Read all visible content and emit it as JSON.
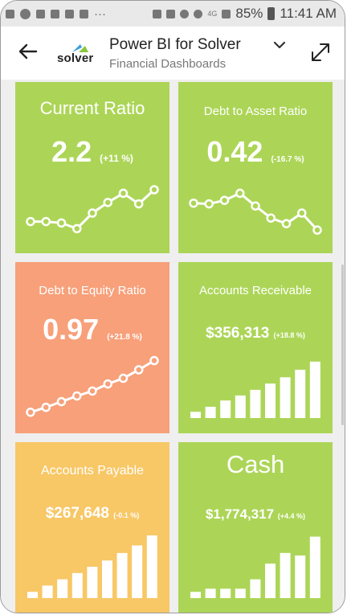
{
  "status": {
    "battery": "85%",
    "time": "11:41 AM",
    "network": "4G"
  },
  "header": {
    "logo": "solver",
    "title": "Power BI for Solver",
    "subtitle": "Financial Dashboards"
  },
  "tiles": [
    {
      "title": "Current Ratio",
      "value": "2.2",
      "change": "(+11 %)",
      "color": "#acd557",
      "visual": "line",
      "chart_data": {
        "type": "line",
        "values": [
          0.3,
          0.3,
          0.28,
          0.2,
          0.42,
          0.57,
          0.7,
          0.55,
          0.75
        ]
      }
    },
    {
      "title": "Debt to Asset Ratio",
      "value": "0.42",
      "change": "(-16.7 %)",
      "color": "#acd557",
      "visual": "line",
      "chart_data": {
        "type": "line",
        "values": [
          0.56,
          0.55,
          0.6,
          0.7,
          0.52,
          0.35,
          0.27,
          0.42,
          0.18
        ]
      }
    },
    {
      "title": "Debt to Equity Ratio",
      "value": "0.97",
      "change": "(+21.8 %)",
      "color": "#f7a07a",
      "visual": "line",
      "chart_data": {
        "type": "line",
        "values": [
          0.15,
          0.22,
          0.3,
          0.38,
          0.45,
          0.55,
          0.63,
          0.75,
          0.88
        ]
      }
    },
    {
      "title": "Accounts Receivable",
      "value": "$356,313",
      "change": "(+18.8 %)",
      "color": "#acd557",
      "visual": "bar",
      "chart_data": {
        "type": "bar",
        "values": [
          0.1,
          0.18,
          0.28,
          0.36,
          0.45,
          0.55,
          0.65,
          0.77,
          0.9
        ]
      }
    },
    {
      "title": "Accounts Payable",
      "value": "$267,648",
      "change": "(-0.1 %)",
      "color": "#f8c766",
      "visual": "bar",
      "chart_data": {
        "type": "bar",
        "values": [
          0.1,
          0.2,
          0.3,
          0.4,
          0.5,
          0.6,
          0.72,
          0.84,
          1.0
        ]
      }
    },
    {
      "title": "Cash",
      "value": "$1,774,317",
      "change": "(+4.4 %)",
      "color": "#acd557",
      "visual": "bar",
      "chart_data": {
        "type": "bar",
        "values": [
          0.1,
          0.15,
          0.15,
          0.15,
          0.3,
          0.55,
          0.72,
          0.68,
          0.98
        ]
      }
    }
  ]
}
